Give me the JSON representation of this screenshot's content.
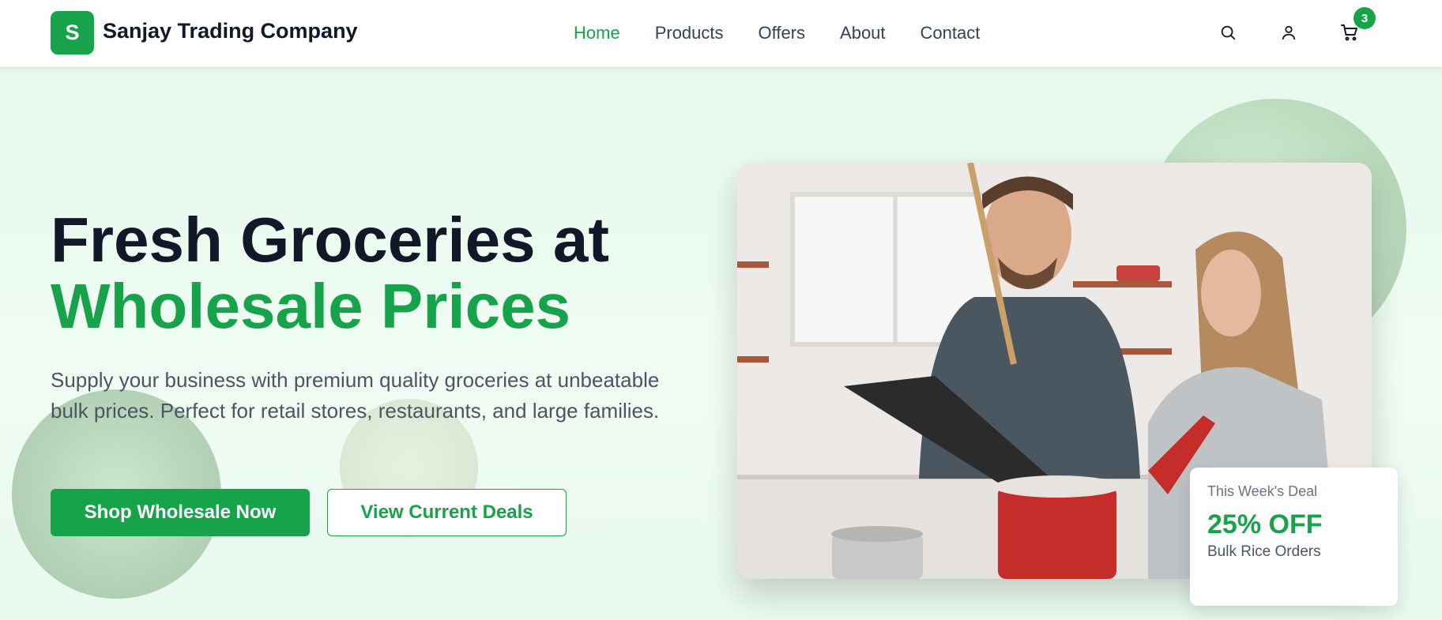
{
  "header": {
    "logo_letter": "S",
    "brand": "Sanjay Trading Company",
    "nav": [
      "Home",
      "Products",
      "Offers",
      "About",
      "Contact"
    ],
    "active_nav": "Home",
    "cart_count": "3",
    "icons": [
      "search-icon",
      "user-icon",
      "cart-icon"
    ]
  },
  "hero": {
    "title_line1": "Fresh Groceries at",
    "title_line2": "Wholesale Prices",
    "lead": "Supply your business with premium quality groceries at unbeatable bulk prices. Perfect for retail stores, restaurants, and large families.",
    "primary_cta": "Shop Wholesale Now",
    "secondary_cta": "View Current Deals"
  },
  "deal_card": {
    "label": "This Week's Deal",
    "amount": "25% OFF",
    "item": "Bulk Rice Orders"
  },
  "colors": {
    "accent": "#16a34a",
    "heading": "#111827",
    "body_text": "#4b5563",
    "hero_bg": "#e6f9ec"
  }
}
